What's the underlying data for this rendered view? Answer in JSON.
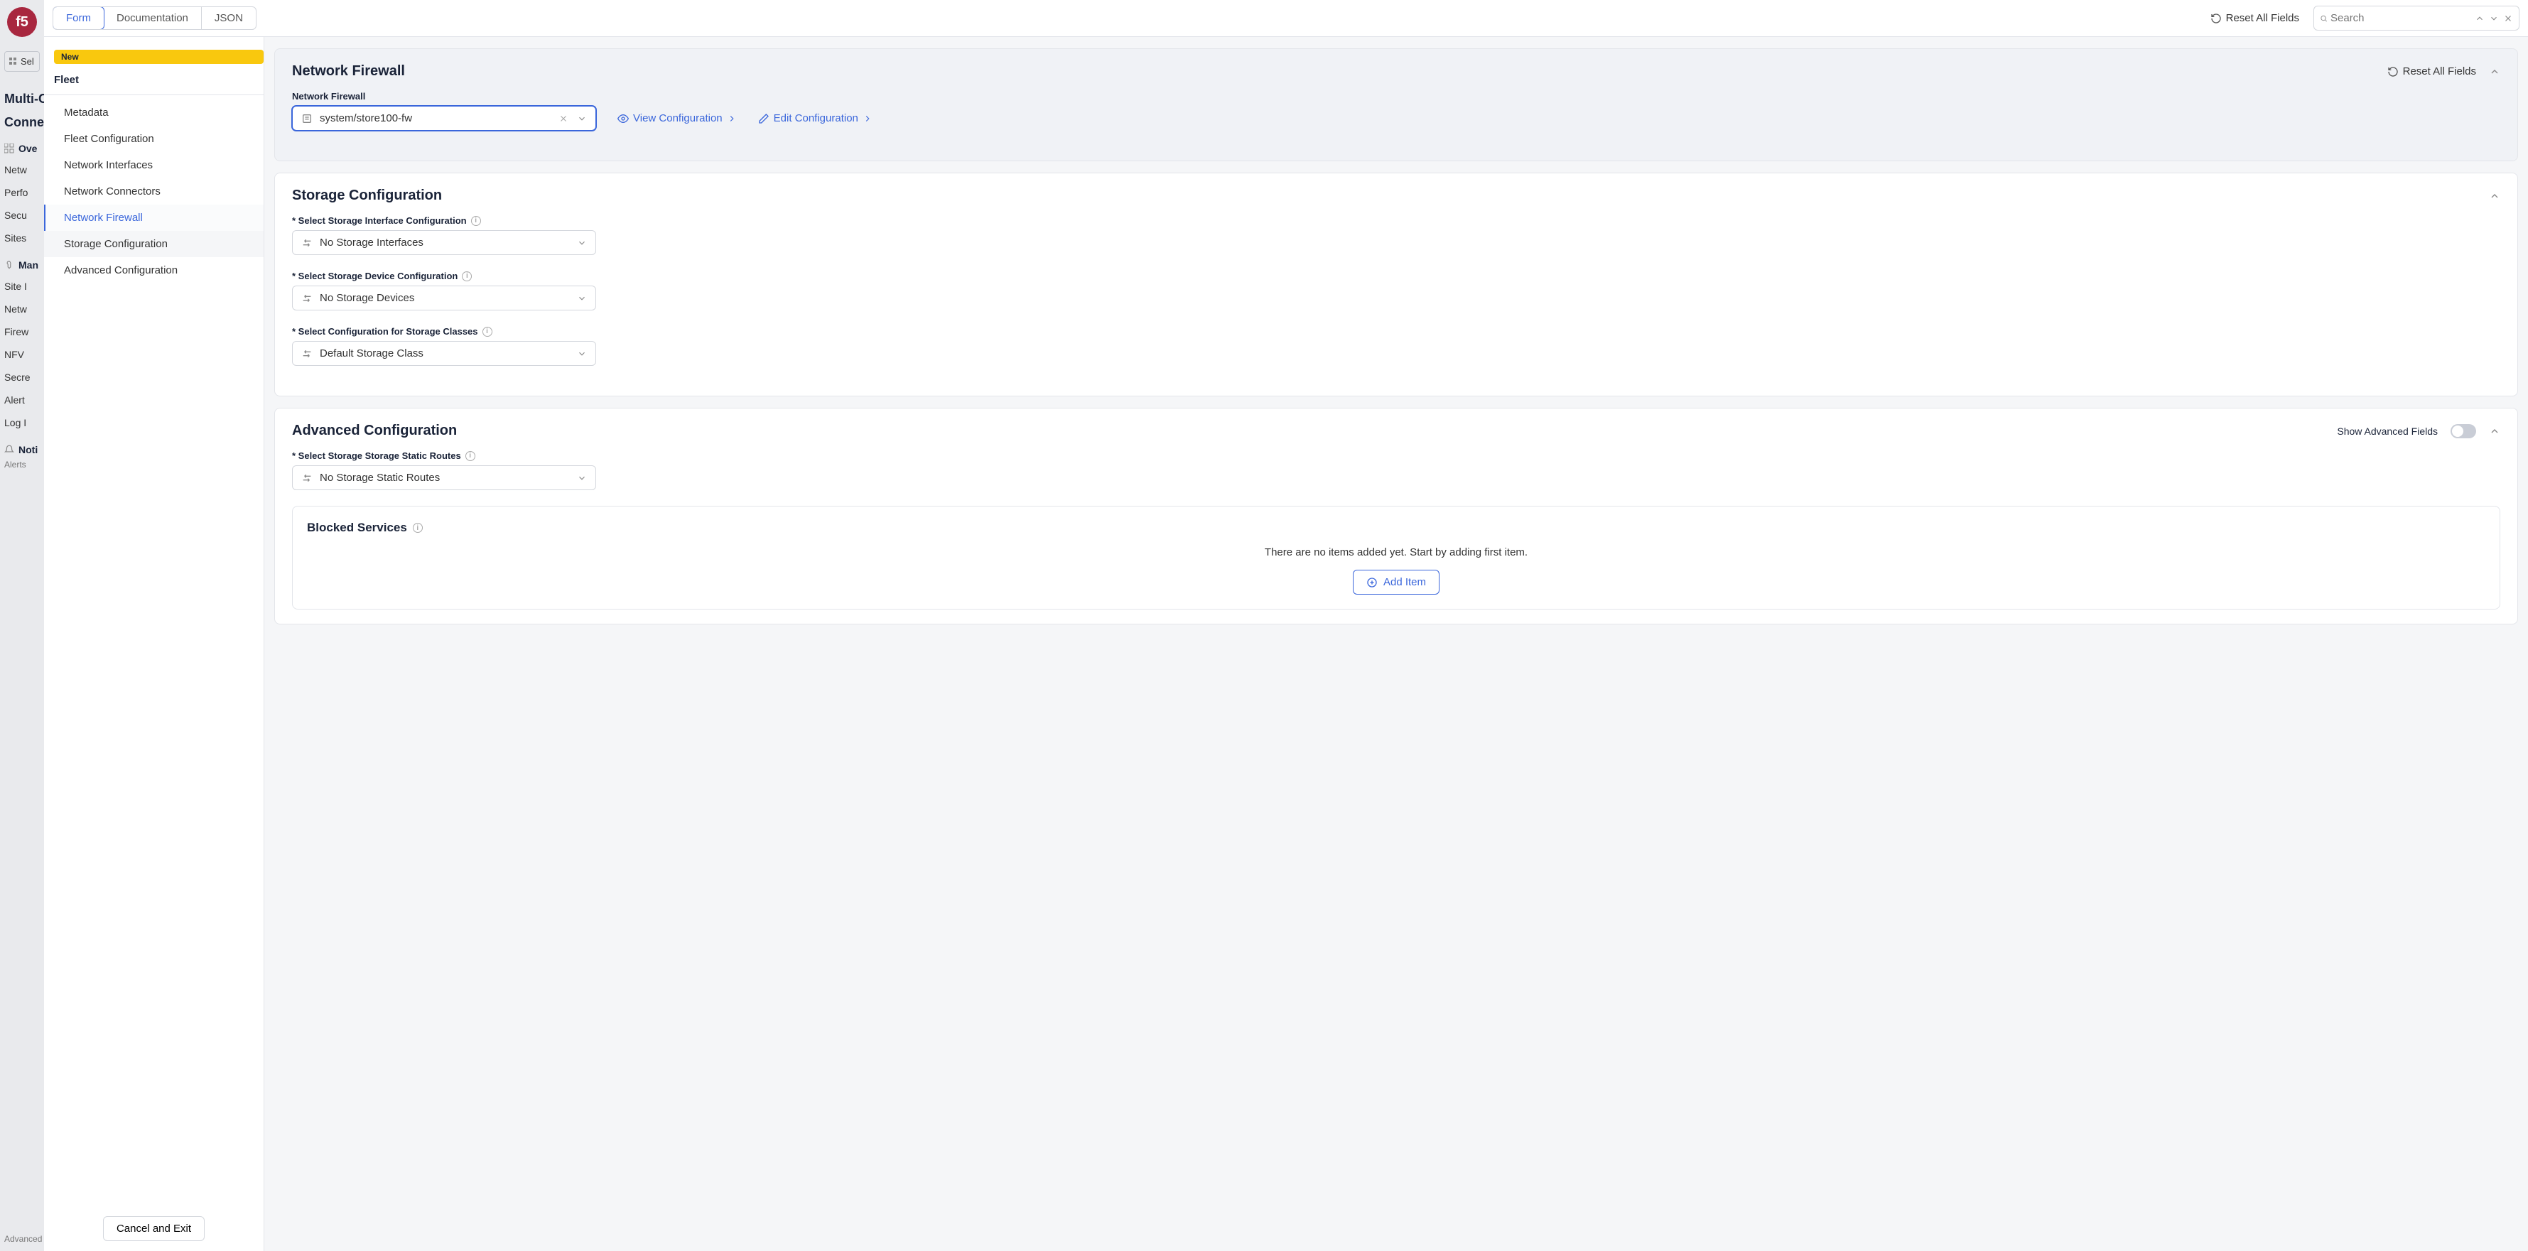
{
  "bg": {
    "logo_text": "f5",
    "select_label": "Sel",
    "title1": "Multi-C",
    "title2": "Connec",
    "overview": "Ove",
    "menu1": [
      "Netw",
      "Perfo",
      "Secu",
      "Sites"
    ],
    "manage": "Man",
    "menu2": [
      "Site I",
      "Netw",
      "Firew",
      "NFV",
      "Secre",
      "Alert",
      "Log I"
    ],
    "notif": "Noti",
    "alerts": "Alerts",
    "advanced": "Advanced"
  },
  "topbar": {
    "tabs": [
      "Form",
      "Documentation",
      "JSON"
    ],
    "active_tab": 0,
    "reset_label": "Reset All Fields",
    "search_placeholder": "Search"
  },
  "leftnav": {
    "badge": "New",
    "heading": "Fleet",
    "items": [
      "Metadata",
      "Fleet Configuration",
      "Network Interfaces",
      "Network Connectors",
      "Network Firewall",
      "Storage Configuration",
      "Advanced Configuration"
    ],
    "active_index": 4,
    "cancel_label": "Cancel and Exit"
  },
  "firewall": {
    "title": "Network Firewall",
    "reset_label": "Reset All Fields",
    "field_label": "Network Firewall",
    "value": "system/store100-fw",
    "view_label": "View Configuration",
    "edit_label": "Edit Configuration"
  },
  "storage": {
    "title": "Storage Configuration",
    "f1_label": "* Select Storage Interface Configuration",
    "f1_value": "No Storage Interfaces",
    "f2_label": "* Select Storage Device Configuration",
    "f2_value": "No Storage Devices",
    "f3_label": "* Select Configuration for Storage Classes",
    "f3_value": "Default Storage Class"
  },
  "advanced": {
    "title": "Advanced Configuration",
    "show_label": "Show Advanced Fields",
    "f1_label": "* Select Storage Storage Static Routes",
    "f1_value": "No Storage Static Routes",
    "blocked_title": "Blocked Services",
    "empty_text": "There are no items added yet. Start by adding first item.",
    "add_label": "Add Item"
  }
}
